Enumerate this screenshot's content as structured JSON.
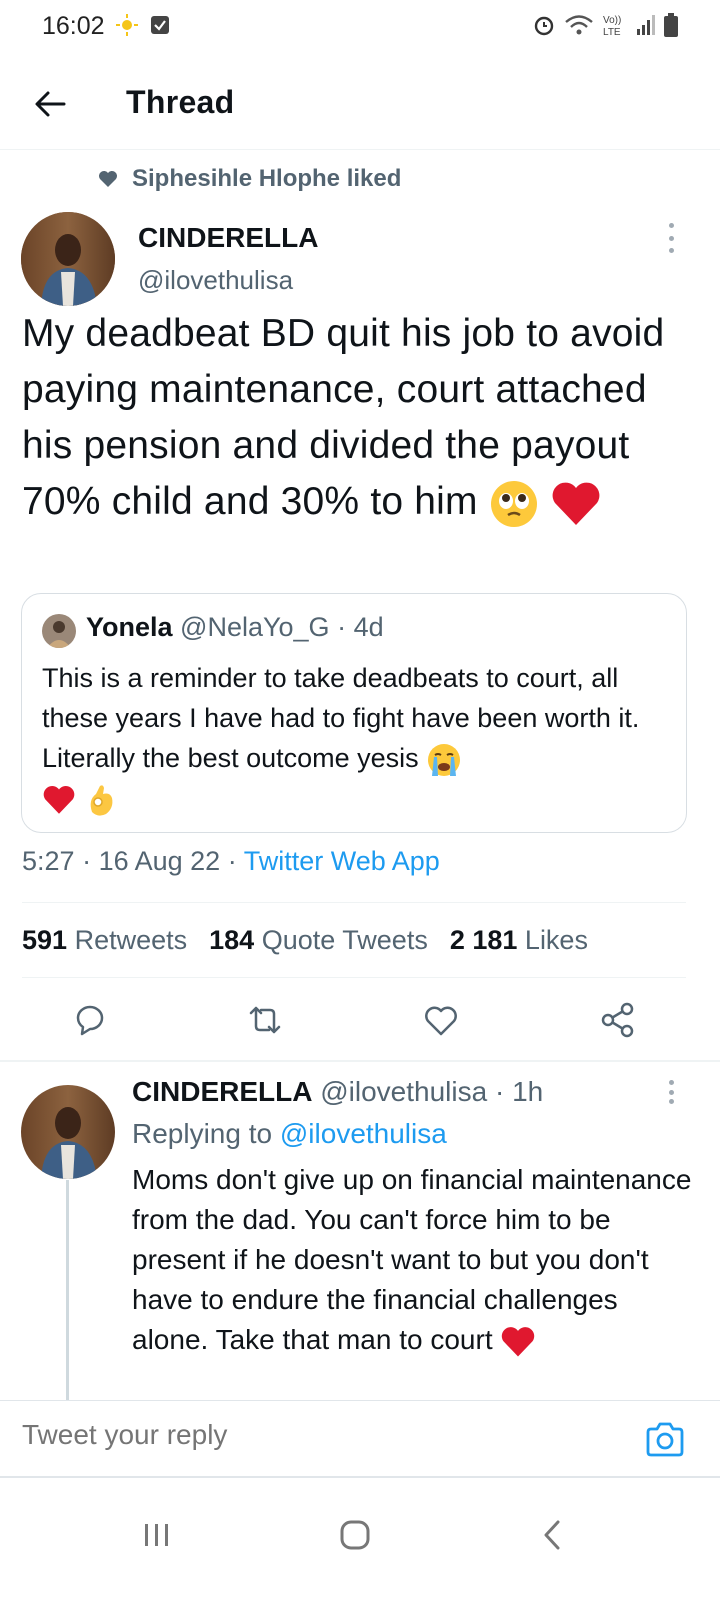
{
  "status_bar": {
    "time": "16:02",
    "icons": [
      "sun-icon",
      "check-notification-icon",
      "alarm-icon",
      "wifi-icon",
      "volte-icon",
      "signal-icon",
      "battery-icon"
    ]
  },
  "header": {
    "title": "Thread"
  },
  "social_context": {
    "text": "Siphesihle Hlophe liked"
  },
  "tweet": {
    "author_name": "CINDERELLA",
    "author_handle": "@ilovethulisa",
    "text": "My deadbeat BD quit his job to avoid paying maintenance, court attached his pension and divided the payout 70% child and 30% to him",
    "time": "5:27",
    "date": "16 Aug 22",
    "client": "Twitter Web App"
  },
  "quote": {
    "name": "Yonela",
    "handle": "@NelaYo_G",
    "age": "4d",
    "text": "This is a reminder to take deadbeats to court, all these years I have had to fight have been worth it. Literally the best outcome yesis"
  },
  "stats": {
    "retweets_count": "591",
    "retweets_label": "Retweets",
    "quotes_count": "184",
    "quotes_label": "Quote Tweets",
    "likes_count": "2 181",
    "likes_label": "Likes"
  },
  "reply": {
    "author_name": "CINDERELLA",
    "author_handle": "@ilovethulisa",
    "age": "1h",
    "replying_prefix": "Replying to",
    "replying_handle": "@ilovethulisa",
    "text": "Moms don't give up on financial maintenance from the dad. You can't force him to be present if he doesn't want to but you don't have to endure the financial challenges alone. Take that man to court"
  },
  "compose": {
    "placeholder": "Tweet your reply"
  },
  "colors": {
    "accent": "#1d9bf0",
    "secondary_text": "#536471",
    "heart_red": "#e0245e"
  }
}
